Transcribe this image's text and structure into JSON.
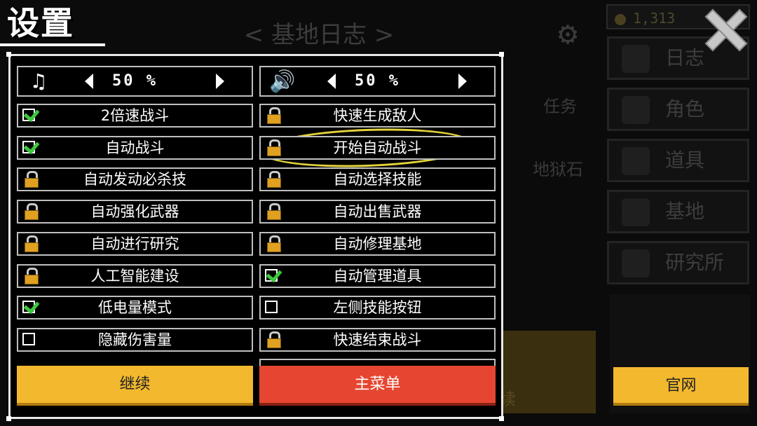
{
  "title": "设置",
  "background": {
    "header": "< 基地日志 >",
    "resource": "1,313",
    "nav": [
      "日志",
      "角色",
      "道具",
      "基地",
      "研究所"
    ],
    "side_items": [
      "任务",
      "地狱石"
    ],
    "bottom_left": "续"
  },
  "music": {
    "icon": "music-note-icon",
    "value": "50 %"
  },
  "sound": {
    "icon": "speaker-icon",
    "value": "50 %"
  },
  "left_options": [
    {
      "label": "2倍速战斗",
      "state": "checked"
    },
    {
      "label": "自动战斗",
      "state": "checked"
    },
    {
      "label": "自动发动必杀技",
      "state": "locked"
    },
    {
      "label": "自动强化武器",
      "state": "locked"
    },
    {
      "label": "自动进行研究",
      "state": "locked"
    },
    {
      "label": "人工智能建设",
      "state": "locked"
    },
    {
      "label": "低电量模式",
      "state": "checked"
    },
    {
      "label": "隐藏伤害量",
      "state": "unchecked"
    }
  ],
  "right_options": [
    {
      "label": "快速生成敌人",
      "state": "locked"
    },
    {
      "label": "开始自动战斗",
      "state": "locked"
    },
    {
      "label": "自动选择技能",
      "state": "locked"
    },
    {
      "label": "自动出售武器",
      "state": "locked"
    },
    {
      "label": "自动修理基地",
      "state": "locked"
    },
    {
      "label": "自动管理道具",
      "state": "checked"
    },
    {
      "label": "左侧技能按钮",
      "state": "unchecked"
    },
    {
      "label": "快速结束战斗",
      "state": "locked"
    }
  ],
  "buttons": {
    "continue": "继续",
    "main_menu": "主菜单",
    "official_site": "官网"
  },
  "colors": {
    "yellow": "#f3b92e",
    "red": "#e64631",
    "check": "#3ec83e",
    "annotation": "#e3d33b"
  }
}
